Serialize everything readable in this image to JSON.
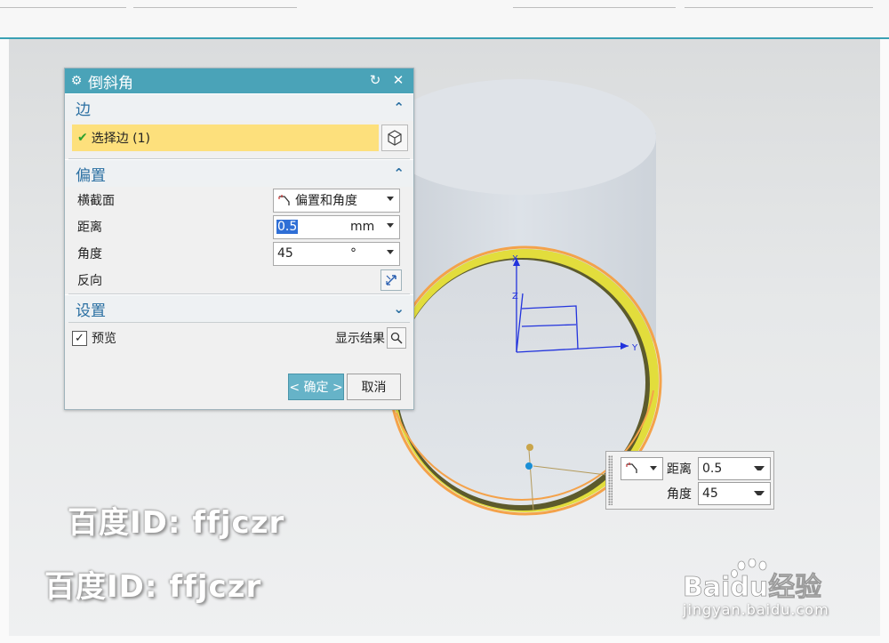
{
  "dialog": {
    "title": "倒斜角",
    "edge_section": {
      "title": "边",
      "select_edge_label": "选择边 (1)"
    },
    "offset_section": {
      "title": "偏置",
      "cross_section": {
        "label": "横截面",
        "value": "偏置和角度"
      },
      "distance": {
        "label": "距离",
        "value": "0.5",
        "unit": "mm"
      },
      "angle": {
        "label": "角度",
        "value": "45",
        "unit": "°"
      },
      "reverse": {
        "label": "反向"
      }
    },
    "settings_section": {
      "title": "设置"
    },
    "preview": {
      "label": "预览",
      "checked": true
    },
    "show_result": {
      "label": "显示结果"
    },
    "ok_label": "< 确定 >",
    "cancel_label": "取消"
  },
  "floating_input": {
    "distance_label": "距离",
    "distance_value": "0.5",
    "angle_label": "角度",
    "angle_value": "45"
  },
  "axes": {
    "x": "X",
    "y": "Y",
    "z": "Z"
  },
  "watermarks": {
    "user_text_1": "百度ID: ffjczr",
    "user_text_2": "百度ID: ffjczr",
    "logo_text": "Baidu经验",
    "site_url": "jingyan.baidu.com"
  },
  "colors": {
    "accent": "#4aa3b8",
    "selected_highlight": "#fde07c",
    "chamfer_yellow": "#e6e13a",
    "edge_orange": "#f4a24a",
    "axis_blue": "#2233dd"
  }
}
